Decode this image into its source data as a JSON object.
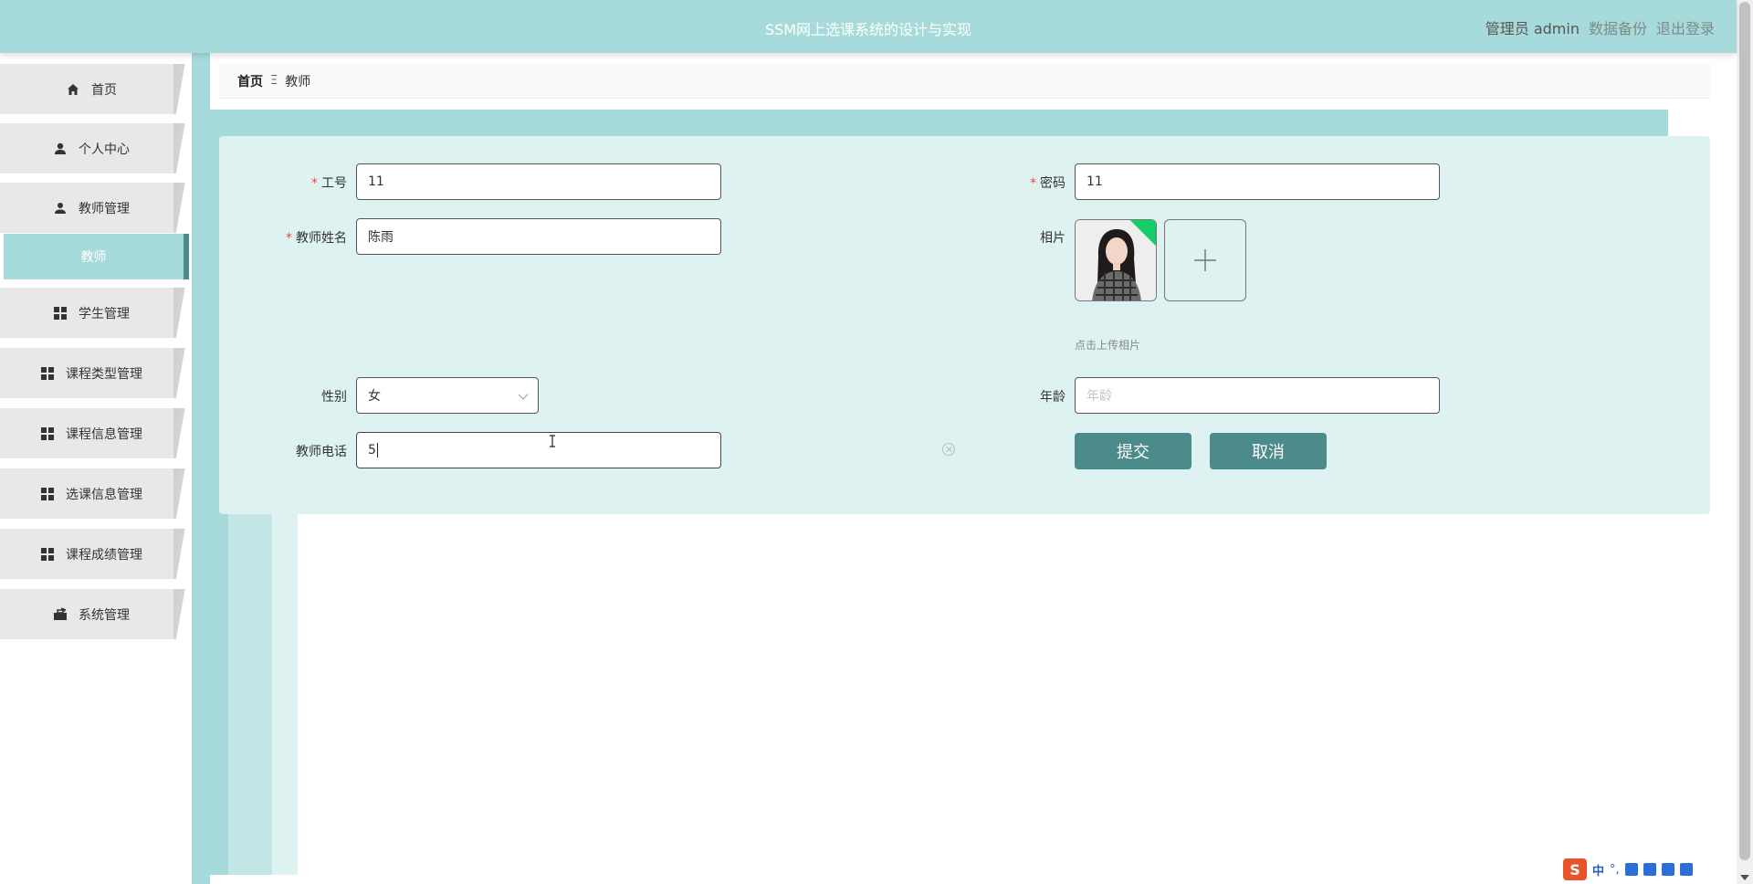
{
  "header": {
    "title": "SSM网上选课系统的设计与实现",
    "user": "管理员 admin",
    "backup": "数据备份",
    "logout": "退出登录"
  },
  "sidebar": {
    "items": [
      {
        "label": "首页",
        "icon": "home-icon"
      },
      {
        "label": "个人中心",
        "icon": "person-icon"
      },
      {
        "label": "教师管理",
        "icon": "person-icon"
      },
      {
        "label": "教师",
        "icon": ""
      },
      {
        "label": "学生管理",
        "icon": "grid-icon"
      },
      {
        "label": "课程类型管理",
        "icon": "grid-icon"
      },
      {
        "label": "课程信息管理",
        "icon": "grid-icon"
      },
      {
        "label": "选课信息管理",
        "icon": "grid-icon"
      },
      {
        "label": "课程成绩管理",
        "icon": "grid-icon"
      },
      {
        "label": "系统管理",
        "icon": "briefcase-icon"
      }
    ]
  },
  "breadcrumb": {
    "home": "首页",
    "separator": "Ξ",
    "current": "教师"
  },
  "form": {
    "job_no_label": "工号",
    "job_no_value": "11",
    "password_label": "密码",
    "password_value": "11",
    "name_label": "教师姓名",
    "name_value": "陈雨",
    "photo_label": "相片",
    "upload_hint": "点击上传相片",
    "gender_label": "性别",
    "gender_value": "女",
    "age_label": "年龄",
    "age_placeholder": "年龄",
    "phone_label": "教师电话",
    "phone_value": "5",
    "submit_label": "提交",
    "cancel_label": "取消"
  },
  "ime": {
    "logo": "S",
    "mode": "中",
    "punct": "°,"
  },
  "colors": {
    "header": "#a7dbdb",
    "accent": "#4b8b8b",
    "card": "#dff2f2"
  }
}
